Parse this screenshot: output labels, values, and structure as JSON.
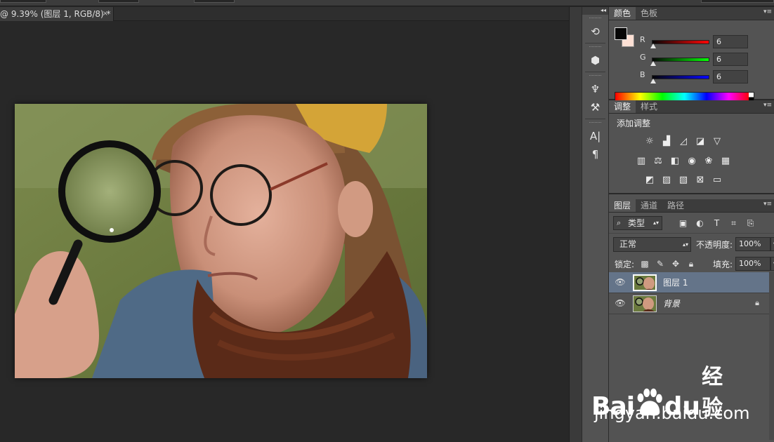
{
  "document": {
    "tab_title": "@ 9.39% (图层 1, RGB/8) *",
    "tab_close": "×"
  },
  "dock": {
    "collapse_label": "◂◂",
    "buttons": [
      "history-icon",
      "3d-icon",
      "brush-presets-icon",
      "tool-presets-icon",
      "character-icon",
      "paragraph-icon"
    ]
  },
  "color_panel": {
    "tabs": [
      "颜色",
      "色板"
    ],
    "active_tab": "颜色",
    "channels": [
      {
        "label": "R",
        "value": "6",
        "color": "#ff0000"
      },
      {
        "label": "G",
        "value": "6",
        "color": "#00cc00"
      },
      {
        "label": "B",
        "value": "6",
        "color": "#0000ff"
      }
    ],
    "foreground_color": "#060606",
    "background_color": "#fde0d4"
  },
  "adjustments_panel": {
    "tabs": [
      "调整",
      "样式"
    ],
    "active_tab": "调整",
    "title": "添加调整",
    "rows": [
      [
        "brightness-contrast-icon",
        "levels-icon",
        "curves-icon",
        "exposure-icon",
        "vibrance-icon"
      ],
      [
        "hue-saturation-icon",
        "color-balance-icon",
        "black-white-icon",
        "photo-filter-icon",
        "channel-mixer-icon",
        "color-lookup-icon"
      ],
      [
        "invert-icon",
        "posterize-icon",
        "threshold-icon",
        "selective-color-icon",
        "gradient-map-icon"
      ]
    ]
  },
  "layers_panel": {
    "tabs": [
      "图层",
      "通道",
      "路径"
    ],
    "active_tab": "图层",
    "kind_filter": "类型",
    "blend_mode": "正常",
    "opacity_label": "不透明度:",
    "opacity": "100%",
    "lock_label": "锁定:",
    "fill_label": "填充:",
    "fill": "100%",
    "layers": [
      {
        "name": "图层 1",
        "selected": true,
        "visible": true,
        "locked": false
      },
      {
        "name": "背景",
        "selected": false,
        "visible": true,
        "locked": true
      }
    ]
  },
  "watermark": {
    "brand_bai": "Bai",
    "brand_du": "du",
    "brand_cn": "经验",
    "url": "jingyan.baidu.com"
  }
}
